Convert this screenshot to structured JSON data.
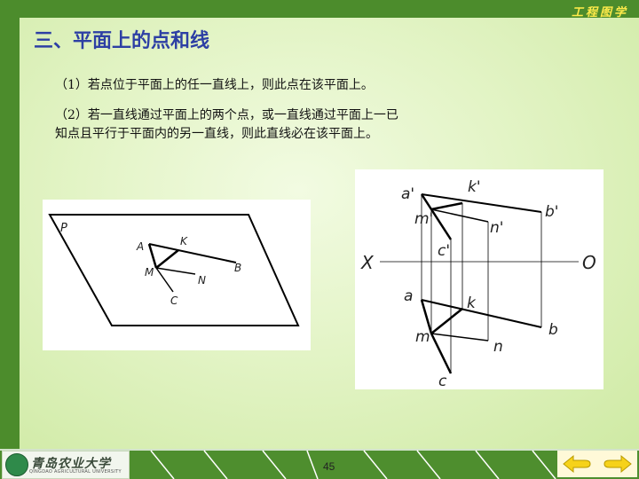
{
  "header": {
    "brand": "工程图学",
    "title": "三、平面上的点和线"
  },
  "content": {
    "rule1": "（1）若点位于平面上的任一直线上，则此点在该平面上。",
    "rule2_line1": "（2）若一直线通过平面上的两个点，或一直线通过平面上一已",
    "rule2_line2": "知点且平行于平面内的另一直线，则此直线必在该平面上。"
  },
  "figure_left": {
    "labels": {
      "P": "P",
      "A": "A",
      "K": "K",
      "M": "M",
      "N": "N",
      "B": "B",
      "C": "C"
    }
  },
  "figure_right": {
    "labels": {
      "a_prime": "a'",
      "k_prime": "k'",
      "b_prime": "b'",
      "m_prime": "m'",
      "n_prime": "n'",
      "c_prime": "c'",
      "X": "X",
      "O": "O",
      "a": "a",
      "k": "k",
      "m": "m",
      "n": "n",
      "b": "b",
      "c": "c"
    }
  },
  "footer": {
    "university_name": "青岛农业大学",
    "university_en": "QINGDAO AGRICULTURAL UNIVERSITY",
    "page_number": "45",
    "prev_label": "previous",
    "next_label": "next"
  },
  "colors": {
    "frame_green": "#4e8e2e",
    "title_blue": "#2d3fa4",
    "brand_yellow": "#ffeb4a",
    "nav_arrow_yellow": "#f6d21a"
  }
}
